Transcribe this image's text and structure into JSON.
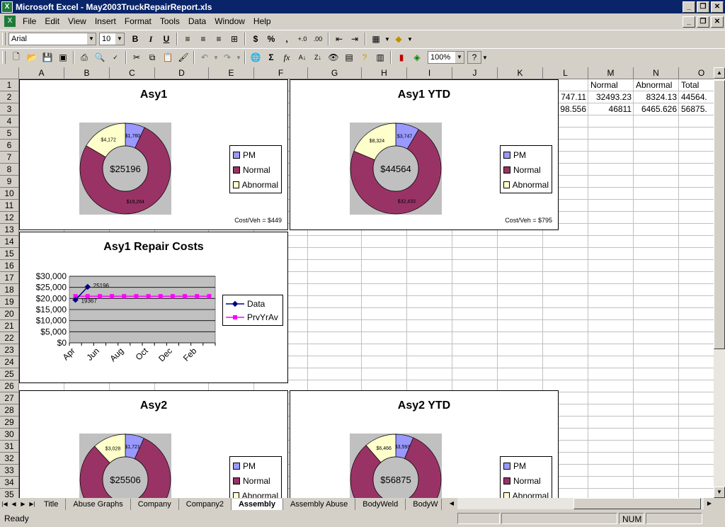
{
  "window": {
    "title": "Microsoft Excel - May2003TruckRepairReport.xls"
  },
  "menu": [
    "File",
    "Edit",
    "View",
    "Insert",
    "Format",
    "Tools",
    "Data",
    "Window",
    "Help"
  ],
  "format_toolbar": {
    "font": "Arial",
    "size": "10"
  },
  "standard_toolbar": {
    "zoom": "100%"
  },
  "columns": [
    "A",
    "B",
    "C",
    "D",
    "E",
    "F",
    "G",
    "H",
    "I",
    "J",
    "K",
    "L",
    "M",
    "N",
    "O"
  ],
  "rows": [
    "1",
    "2",
    "3",
    "4",
    "5",
    "6",
    "7",
    "8",
    "9",
    "10",
    "11",
    "12",
    "13",
    "14",
    "15",
    "16",
    "17",
    "18",
    "19",
    "20",
    "21",
    "22",
    "23",
    "24",
    "25",
    "26",
    "27",
    "28",
    "29",
    "30",
    "31",
    "32",
    "33",
    "34",
    "35"
  ],
  "cells": {
    "m1": "Normal",
    "n1": "Abnormal",
    "o1": "Total",
    "l2": "747.11",
    "m2": "32493.23",
    "n2": "8324.13",
    "o2": "44564.",
    "l3": "98.556",
    "m3": "46811",
    "n3": "6465.626",
    "o3": "56875."
  },
  "colors": {
    "pm": "#9999ff",
    "normal": "#993366",
    "abnormal": "#ffffcc",
    "plot_bg": "#c0c0c0",
    "data_line": "#000080",
    "prev_line": "#ff00ff"
  },
  "legend": {
    "pm": "PM",
    "normal": "Normal",
    "abnormal": "Abnormal"
  },
  "charts": {
    "asy1": {
      "title": "Asy1",
      "center": "$25196",
      "cost_per_veh": "Cost/Veh = $449",
      "labels": {
        "pm": "$1,760",
        "normal": "$19,264",
        "abnormal": "$4,172"
      }
    },
    "asy1ytd": {
      "title": "Asy1 YTD",
      "center": "$44564",
      "cost_per_veh": "Cost/Veh = $795",
      "labels": {
        "pm": "$3,747",
        "normal": "$32,433",
        "abnormal": "$8,324"
      }
    },
    "asy2": {
      "title": "Asy2",
      "center": "$25506",
      "labels": {
        "pm": "$1,721",
        "abnormal": "$3,028"
      }
    },
    "asy2ytd": {
      "title": "Asy2 YTD",
      "center": "$56875",
      "labels": {
        "pm": "$3,593",
        "abnormal": "$6,466"
      }
    },
    "repair": {
      "title": "Asy1 Repair Costs",
      "legend_data": "Data",
      "legend_prev": "PrvYrAv"
    }
  },
  "chart_data": [
    {
      "type": "pie",
      "title": "Asy1",
      "categories": [
        "PM",
        "Normal",
        "Abnormal"
      ],
      "values": [
        1760,
        19264,
        4172
      ]
    },
    {
      "type": "pie",
      "title": "Asy1 YTD",
      "categories": [
        "PM",
        "Normal",
        "Abnormal"
      ],
      "values": [
        3747,
        32433,
        8324
      ]
    },
    {
      "type": "pie",
      "title": "Asy2",
      "categories": [
        "PM",
        "Normal",
        "Abnormal"
      ],
      "values": [
        1721,
        20757,
        3028
      ]
    },
    {
      "type": "pie",
      "title": "Asy2 YTD",
      "categories": [
        "PM",
        "Normal",
        "Abnormal"
      ],
      "values": [
        3593,
        46816,
        6466
      ]
    },
    {
      "type": "line",
      "title": "Asy1 Repair Costs",
      "categories": [
        "Apr",
        "May",
        "Jun",
        "Jul",
        "Aug",
        "Sep",
        "Oct",
        "Nov",
        "Dec",
        "Jan",
        "Feb",
        "Mar"
      ],
      "x_tick_labels": [
        "Apr",
        "Jun",
        "Aug",
        "Oct",
        "Dec",
        "Feb"
      ],
      "y_tick_labels": [
        "$0",
        "$5,000",
        "$10,000",
        "$15,000",
        "$20,000",
        "$25,000",
        "$30,000"
      ],
      "ylim": [
        0,
        30000
      ],
      "point_labels": [
        "19367",
        "25196"
      ],
      "series": [
        {
          "name": "Data",
          "values": [
            19367,
            25196,
            null,
            null,
            null,
            null,
            null,
            null,
            null,
            null,
            null,
            null
          ]
        },
        {
          "name": "PrvYrAv",
          "values": [
            21000,
            21000,
            21000,
            21000,
            21000,
            21000,
            21000,
            21000,
            21000,
            21000,
            21000,
            21000
          ]
        }
      ],
      "legend": "right",
      "grid": true
    }
  ],
  "sheet_tabs": [
    "Title",
    "Abuse Graphs",
    "Company",
    "Company2",
    "Assembly",
    "Assembly Abuse",
    "BodyWeld",
    "BodyW"
  ],
  "active_tab": "Assembly",
  "status": {
    "left": "Ready",
    "num": "NUM"
  }
}
